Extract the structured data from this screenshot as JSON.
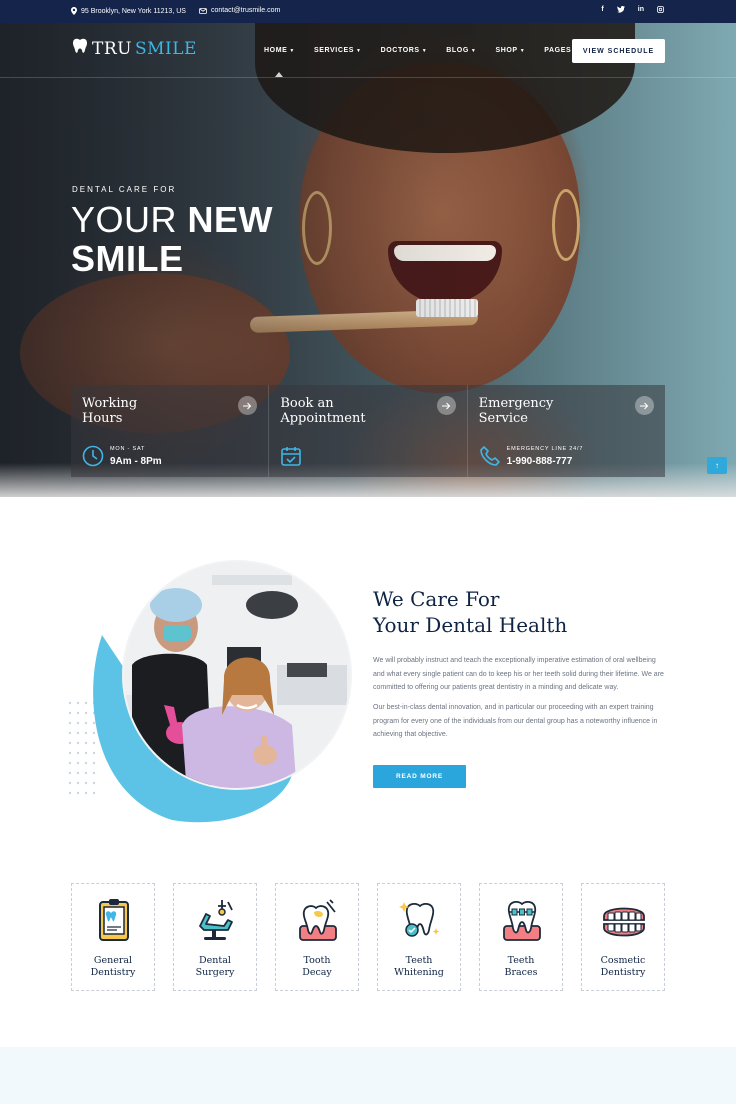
{
  "topbar": {
    "address": "95 Brooklyn, New York 11213, US",
    "email": "contact@trusmile.com",
    "socials": [
      "f",
      "t",
      "in",
      "ig"
    ]
  },
  "brand": {
    "logo_part1": "TRU",
    "logo_part2": "SMILE",
    "accent": "#3fb6e6",
    "navy": "#14244a"
  },
  "nav": {
    "items": [
      {
        "label": "HOME"
      },
      {
        "label": "SERVICES"
      },
      {
        "label": "DOCTORS"
      },
      {
        "label": "BLOG"
      },
      {
        "label": "SHOP"
      },
      {
        "label": "PAGES"
      }
    ],
    "cta": "VIEW SCHEDULE"
  },
  "hero": {
    "eyebrow": "DENTAL CARE FOR",
    "title_light": "YOUR ",
    "title_bold": "NEW",
    "title_line2": "SMILE"
  },
  "cards": [
    {
      "title": "Working\nHours",
      "small": "MON - SAT",
      "big": "9Am - 8Pm",
      "icon": "clock-icon"
    },
    {
      "title": "Book an\nAppointment",
      "small": "",
      "big": "",
      "icon": "calendar-check-icon"
    },
    {
      "title": "Emergency\nService",
      "small": "EMERGENCY LINE 24/7",
      "big": "1-990-888-777",
      "icon": "phone-icon"
    }
  ],
  "about": {
    "title_line1": "We Care For",
    "title_line2": "Your Dental Health",
    "p1": "We will probably instruct and teach the exceptionally imperative estimation of oral wellbeing and what every single patient can do to keep his or her teeth solid during their lifetime. We are committed to offering our patients great dentistry in a minding and delicate way.",
    "p2": "Our best-in-class dental innovation, and in particular our proceeding with an expert training program for every one of the individuals from our dental group has a noteworthy influence in achieving that objective.",
    "button": "READ MORE"
  },
  "services": [
    {
      "label": "General\nDentistry",
      "icon": "clipboard-tooth-icon"
    },
    {
      "label": "Dental\nSurgery",
      "icon": "dental-chair-icon"
    },
    {
      "label": "Tooth\nDecay",
      "icon": "tooth-decay-icon"
    },
    {
      "label": "Teeth\nWhitening",
      "icon": "sparkling-tooth-icon"
    },
    {
      "label": "Teeth\nBraces",
      "icon": "braces-icon"
    },
    {
      "label": "Cosmetic\nDentistry",
      "icon": "dentures-icon"
    }
  ],
  "scroll_top": "↑"
}
